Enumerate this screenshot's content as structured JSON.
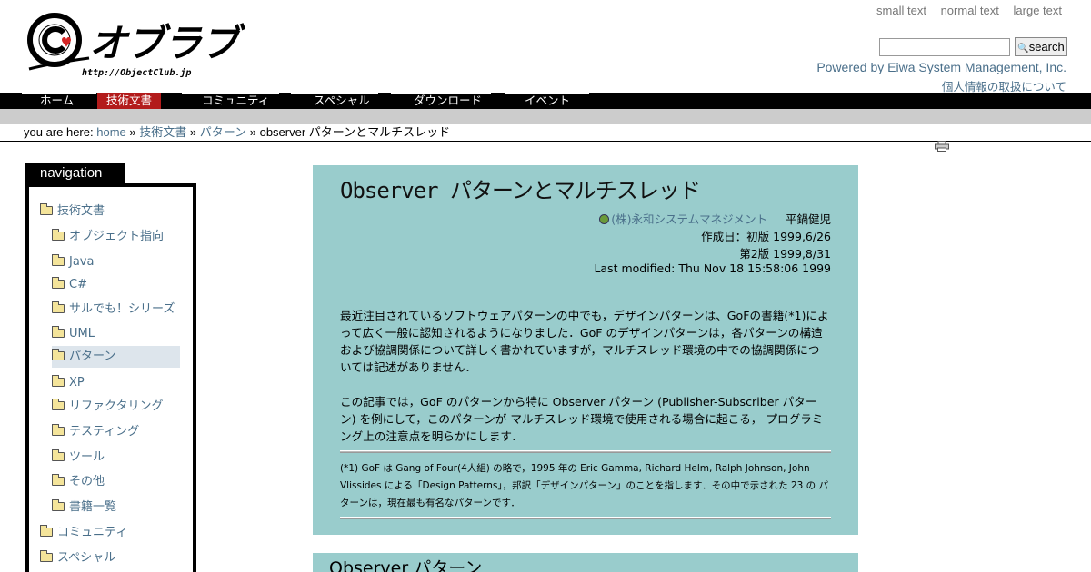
{
  "header": {
    "logo_text": "オブラブ",
    "logo_url": "http://ObjectClub.jp",
    "font_sizes": [
      "small text",
      "normal text",
      "large text"
    ],
    "search_button": "search",
    "search_value": "",
    "powered_by": "Powered by Eiwa System Management, Inc.",
    "privacy": "個人情報の取扱について"
  },
  "nav": {
    "tabs": [
      "ホーム",
      "技術文書",
      "コミュニティ",
      "スペシャル",
      "ダウンロード",
      "イベント"
    ],
    "active": "技術文書"
  },
  "breadcrumb": {
    "prefix": "you are here:",
    "items": [
      "home",
      "技術文書",
      "パターン"
    ],
    "current": "observer パターンとマルチスレッド",
    "sep": "»"
  },
  "sidebar": {
    "heading": "navigation",
    "items": [
      {
        "label": "技術文書",
        "level": 0
      },
      {
        "label": "オブジェクト指向",
        "level": 1
      },
      {
        "label": "Java",
        "level": 1
      },
      {
        "label": "C#",
        "level": 1
      },
      {
        "label": "サルでも！シリーズ",
        "level": 1
      },
      {
        "label": "UML",
        "level": 1
      },
      {
        "label": "パターン",
        "level": 1,
        "selected": true
      },
      {
        "label": "XP",
        "level": 1
      },
      {
        "label": "リファクタリング",
        "level": 1
      },
      {
        "label": "テスティング",
        "level": 1
      },
      {
        "label": "ツール",
        "level": 1
      },
      {
        "label": "その他",
        "level": 1
      },
      {
        "label": "書籍一覧",
        "level": 1
      },
      {
        "label": "コミュニティ",
        "level": 0
      },
      {
        "label": "スペシャル",
        "level": 0
      }
    ]
  },
  "article": {
    "title": "Observer パターンとマルチスレッド",
    "company": "(株)永和システムマネジメント",
    "author": "平鍋健児",
    "created": "作成日：初版 1999,6/26",
    "revised": "第2版 1999,8/31",
    "modified": "Last modified: Thu Nov 18 15:58:06 1999",
    "para1": "最近注目されているソフトウェアパターンの中でも，デザインパターンは、GoFの書籍(*1)によって広く一般に認知されるようになりました．GoF のデザインパターンは，各パターンの構造および協調関係について詳しく書かれていますが，マルチスレッド環境の中での協調関係については記述がありません．",
    "para2": "この記事では，GoF のパターンから特に Observer パターン (Publisher-Subscriber パターン) を例にして，このパターンが マルチスレッド環境で使用される場合に起こる， プログラミング上の注意点を明らかにします．",
    "footnote": "(*1) GoF は Gang of Four(4人組) の略で，1995 年の Eric Gamma, Richard Helm, Ralph Johnson, John Vlissides による「Design Patterns」，邦訳「デザインパターン」のことを指します．その中で示された 23 の パターンは，現在最も有名なパターンです．",
    "section2": "Observer パターン"
  },
  "colors": {
    "card_bg": "#99cccc",
    "link": "#4a6f8a",
    "active_tab": "#b31b1b"
  }
}
